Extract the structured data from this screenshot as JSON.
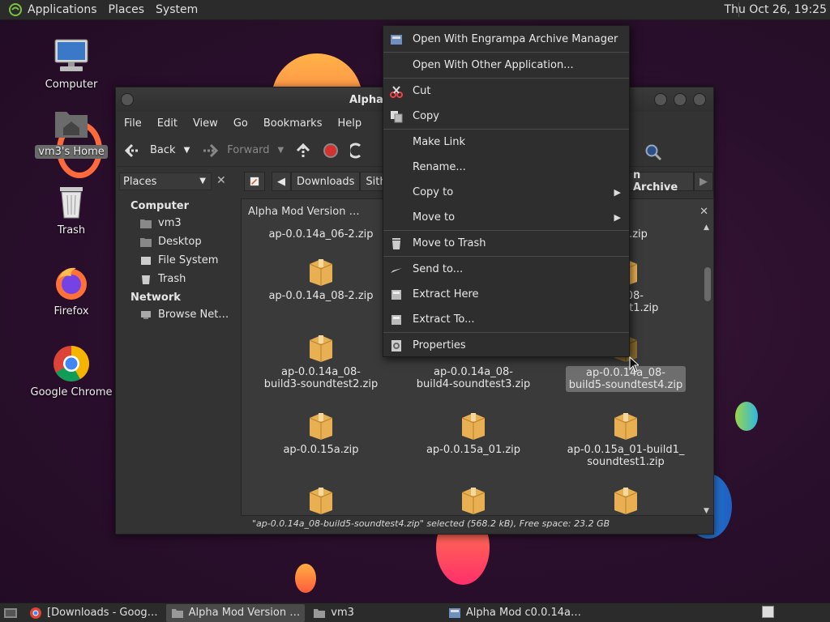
{
  "top_panel": {
    "menus": [
      "Applications",
      "Places",
      "System"
    ],
    "clock": "Thu Oct 26, 19:25"
  },
  "desktop": {
    "icons": [
      {
        "label": "Computer"
      },
      {
        "label": "vm3's Home"
      },
      {
        "label": "Trash"
      },
      {
        "label": "Firefox"
      },
      {
        "label": "Google Chrome"
      }
    ]
  },
  "window": {
    "title": "Alpha M",
    "menus": [
      "File",
      "Edit",
      "View",
      "Go",
      "Bookmarks",
      "Help"
    ],
    "toolbar": {
      "back": "Back",
      "forward": "Forward"
    },
    "places_dropdown": "Places",
    "breadcrumbs": [
      "Downloads",
      "Sith"
    ],
    "breadcrumb_right": "n Archive",
    "sidebar": {
      "computer_header": "Computer",
      "computer_items": [
        "vm3",
        "Desktop",
        "File System",
        "Trash"
      ],
      "network_header": "Network",
      "network_items": [
        "Browse Net…"
      ]
    },
    "content_tab": "Alpha Mod Version …",
    "files": [
      {
        "name": "ap-0.0.14a_06-2.zip"
      },
      {
        "name": "a_08.zip"
      },
      {
        "name": "ap-0.0.14a_08-2.zip"
      },
      {
        "name": "4a_08-\nundtest1.zip"
      },
      {
        "name": "ap-0.0.14a_08-\nbuild3-soundtest2.zip"
      },
      {
        "name": "ap-0.0.14a_08-\nbuild4-soundtest3.zip"
      },
      {
        "name": "ap-0.0.14a_08-\nbuild5-soundtest4.zip"
      },
      {
        "name": "ap-0.0.15a.zip"
      },
      {
        "name": "ap-0.0.15a_01.zip"
      },
      {
        "name": "ap-0.0.15a_01-build1_\nsoundtest1.zip"
      }
    ],
    "status": "\"ap-0.0.14a_08-build5-soundtest4.zip\" selected (568.2 kB), Free space: 23.2 GB"
  },
  "context_menu": {
    "items": [
      {
        "label": "Open With Engrampa Archive Manager",
        "icon": "archive-icon"
      },
      {
        "label": "Open With Other Application...",
        "icon": ""
      },
      {
        "label": "Cut",
        "icon": "scissors-icon"
      },
      {
        "label": "Copy",
        "icon": "copy-icon"
      },
      {
        "label": "Make Link",
        "icon": ""
      },
      {
        "label": "Rename...",
        "icon": ""
      },
      {
        "label": "Copy to",
        "icon": "",
        "submenu": true
      },
      {
        "label": "Move to",
        "icon": "",
        "submenu": true
      },
      {
        "label": "Move to Trash",
        "icon": "trash-icon"
      },
      {
        "label": "Send to...",
        "icon": "send-icon"
      },
      {
        "label": "Extract Here",
        "icon": "extract-icon"
      },
      {
        "label": "Extract To...",
        "icon": "extract-icon"
      },
      {
        "label": "Properties",
        "icon": "properties-icon"
      }
    ]
  },
  "taskbar": {
    "tasks": [
      {
        "label": "[Downloads - Goog…",
        "active": false
      },
      {
        "label": "Alpha Mod Version …",
        "active": true
      },
      {
        "label": "vm3",
        "active": false
      },
      {
        "label": "Alpha Mod c0.0.14a…",
        "active": false
      }
    ]
  }
}
